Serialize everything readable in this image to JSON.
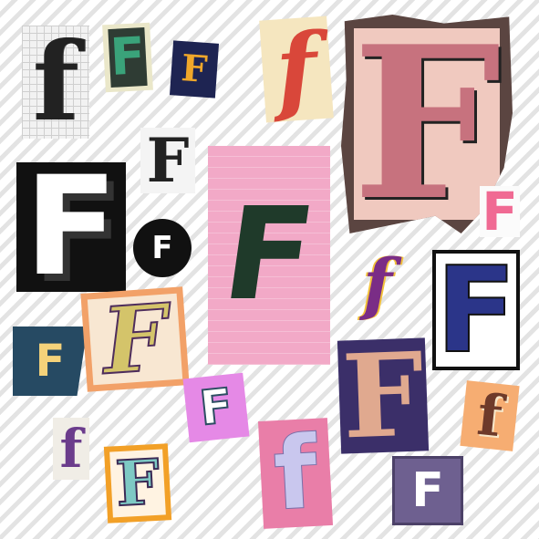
{
  "collage": {
    "pieces": [
      {
        "id": "grid-black-f",
        "glyph": "f",
        "fg": "#222222"
      },
      {
        "id": "green-F",
        "glyph": "F",
        "fg": "#3aa37a"
      },
      {
        "id": "navy-orange-F",
        "glyph": "F",
        "fg": "#f0a72a"
      },
      {
        "id": "cream-red-f",
        "glyph": "f",
        "fg": "#d9473a"
      },
      {
        "id": "big-brown-F",
        "glyph": "F",
        "fg": "#c7727e"
      },
      {
        "id": "grunge-F",
        "glyph": "F",
        "fg": "#222222"
      },
      {
        "id": "block-white-F",
        "glyph": "F",
        "fg": "#ffffff"
      },
      {
        "id": "circle-F",
        "glyph": "F",
        "fg": "#ffffff"
      },
      {
        "id": "pink-paper-F",
        "glyph": "F",
        "fg": "#1f3a2a"
      },
      {
        "id": "pink-small-F",
        "glyph": "F",
        "fg": "#f06a93"
      },
      {
        "id": "purple-script-f",
        "glyph": "f",
        "fg": "#7a2d86"
      },
      {
        "id": "varsity-F",
        "glyph": "F",
        "fg": "#2b3589"
      },
      {
        "id": "teal-F",
        "glyph": "F",
        "fg": "#f4d27a"
      },
      {
        "id": "khaki-script-F",
        "glyph": "F",
        "fg": "#d4c46a"
      },
      {
        "id": "violet-F",
        "glyph": "F",
        "fg": "#e0a98f"
      },
      {
        "id": "lilac-F",
        "glyph": "F",
        "fg": "#ffffff"
      },
      {
        "id": "purple-f",
        "glyph": "f",
        "fg": "#6b3c8c"
      },
      {
        "id": "orange-teal-F",
        "glyph": "F",
        "fg": "#7ec9c4"
      },
      {
        "id": "lavender-f",
        "glyph": "f",
        "fg": "#c9c7ee"
      },
      {
        "id": "grey-F",
        "glyph": "F",
        "fg": "#ffffff"
      },
      {
        "id": "brown-f",
        "glyph": "f",
        "fg": "#6e3a2a"
      }
    ]
  }
}
